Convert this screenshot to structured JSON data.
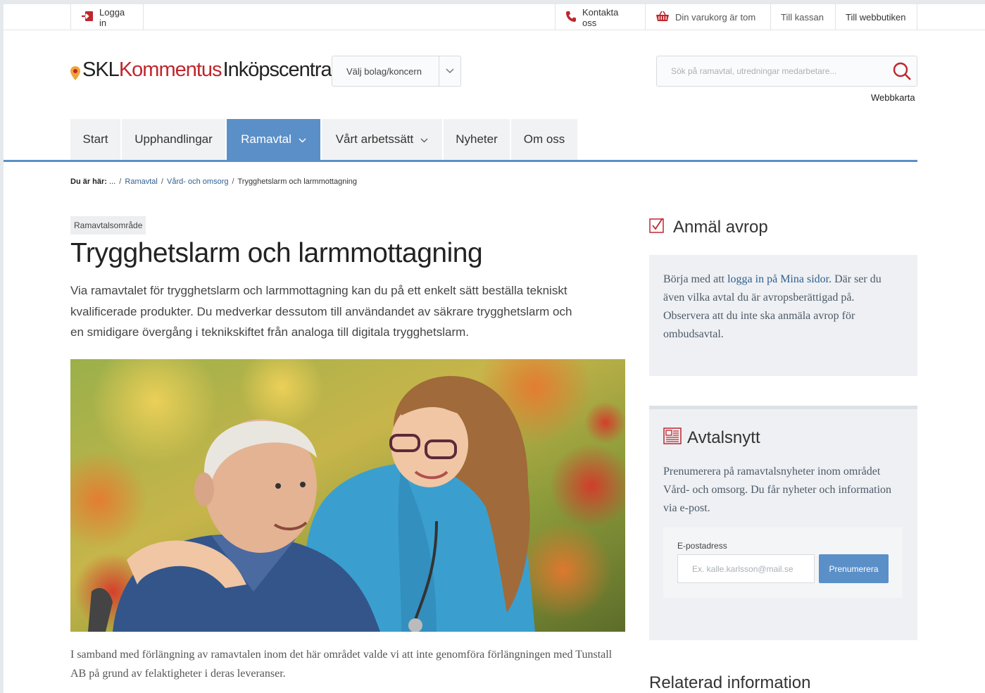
{
  "utility_bar": {
    "login": "Logga in",
    "contact": "Kontakta oss",
    "cart": "Din varukorg är tom",
    "checkout": "Till kassan",
    "webshop": "Till webbutiken"
  },
  "header": {
    "logo": {
      "part1": "SKL",
      "part2": "Kommentus",
      "part3": "Inköpscentral"
    },
    "company_select": "Välj bolag/koncern",
    "search_placeholder": "Sök på ramavtal, utredningar medarbetare...",
    "sitemap": "Webbkarta"
  },
  "nav": {
    "items": [
      {
        "label": "Start"
      },
      {
        "label": "Upphandlingar"
      },
      {
        "label": "Ramavtal"
      },
      {
        "label": "Vårt arbetssätt"
      },
      {
        "label": "Nyheter"
      },
      {
        "label": "Om oss"
      }
    ],
    "active": "Ramavtal"
  },
  "breadcrumb": {
    "lead": "Du är här:",
    "ellipsis": "...",
    "items": [
      "Ramavtal",
      "Vård- och omsorg",
      "Trygghetslarm och larmmottagning"
    ]
  },
  "article": {
    "tag": "Ramavtalsområde",
    "title": "Trygghetslarm och larmmottagning",
    "lead": "Via ramavtalet för trygghetslarm och larmmottagning kan du på ett enkelt sätt beställa tekniskt kvalificerade produkter. Du medverkar dessutom till användandet av säkrare trygghetslarm och en smidigare övergång i teknikskiftet från analoga till digitala trygghetslarm.",
    "caption": "I samband med förlängning av ramavtalen inom det här området valde vi att inte genomföra förlängningen med Tunstall AB på grund av felaktigheter i deras leveranser."
  },
  "sidebar": {
    "avrop": {
      "title": "Anmäl avrop",
      "text_before": "Börja med att ",
      "link": "logga in på Mina sidor",
      "text_after": ". Där ser du även vilka avtal du är avropsberättigad på. Observera att du inte ska anmäla avrop för ombudsavtal."
    },
    "news": {
      "title": "Avtalsnytt",
      "text": "Prenumerera på ramavtalsnyheter inom området Vård- och omsorg. Du får nyheter och information via e-post.",
      "email_label": "E-postadress",
      "email_placeholder": "Ex. kalle.karlsson@mail.se",
      "subscribe": "Prenumerera"
    },
    "related": "Relaterad information"
  },
  "colors": {
    "brand_red": "#c0262d",
    "accent_blue": "#5b8fc7",
    "link_blue": "#2f5f91"
  },
  "icons": [
    "login-icon",
    "phone-icon",
    "basket-icon",
    "chevron-down-icon",
    "search-icon",
    "checkbox-icon",
    "newspaper-icon",
    "logo-pin-icon"
  ]
}
